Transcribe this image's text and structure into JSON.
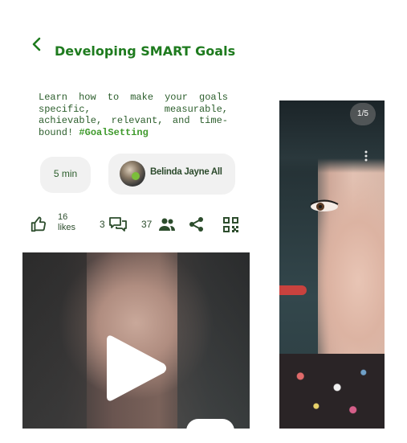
{
  "header": {
    "title": "Developing SMART Goals"
  },
  "description": {
    "text": "Learn how to make your goals specific, measurable, achievable, relevant, and time-bound!",
    "hashtag": "#GoalSetting"
  },
  "chips": {
    "duration": "5 min",
    "author_name": "Belinda Jayne All"
  },
  "stats": {
    "likes_number": "16",
    "likes_label": "likes",
    "comments_count": "3",
    "viewers_count": "37"
  },
  "side_card": {
    "page_indicator": "1/5"
  },
  "icons": {
    "back": "chevron-left-icon",
    "like": "thumbs-up-icon",
    "comments": "comments-icon",
    "people": "people-icon",
    "share": "share-icon",
    "qr": "qr-code-icon",
    "play": "play-icon",
    "more": "more-vertical-icon"
  },
  "colors": {
    "accent_green": "#1e7b1e",
    "hashtag_green": "#3f9a2c",
    "text_dark_green": "#2c5e2c",
    "chip_bg": "#f1f1f1"
  }
}
